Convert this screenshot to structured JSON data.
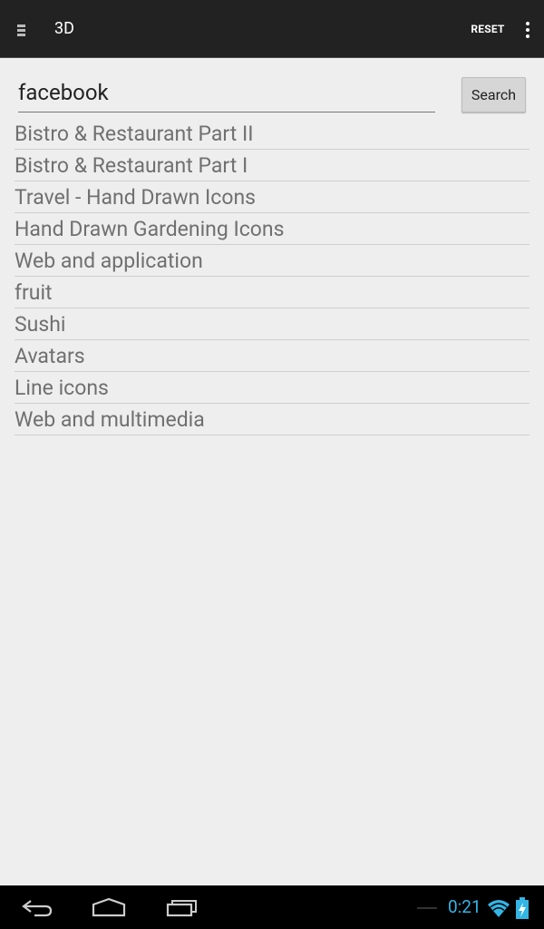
{
  "action_bar": {
    "title": "3D",
    "reset_label": "RESET"
  },
  "search": {
    "value": "facebook",
    "button_label": "Search"
  },
  "results": [
    "Bistro & Restaurant Part II",
    "Bistro & Restaurant Part I",
    "Travel - Hand Drawn Icons",
    "Hand Drawn Gardening Icons",
    "Web and application",
    "fruit",
    "Sushi",
    "Avatars",
    "Line icons",
    "Web and multimedia"
  ],
  "status": {
    "time": "0:21"
  },
  "icons": {
    "drawer": "menu-icon",
    "overflow": "overflow-menu-icon",
    "back": "back-icon",
    "home": "home-icon",
    "recent": "recent-apps-icon",
    "wifi": "wifi-icon",
    "battery": "battery-charging-icon"
  },
  "colors": {
    "action_bar": "#222222",
    "accent": "#33b5e5",
    "list_text": "#707070"
  }
}
